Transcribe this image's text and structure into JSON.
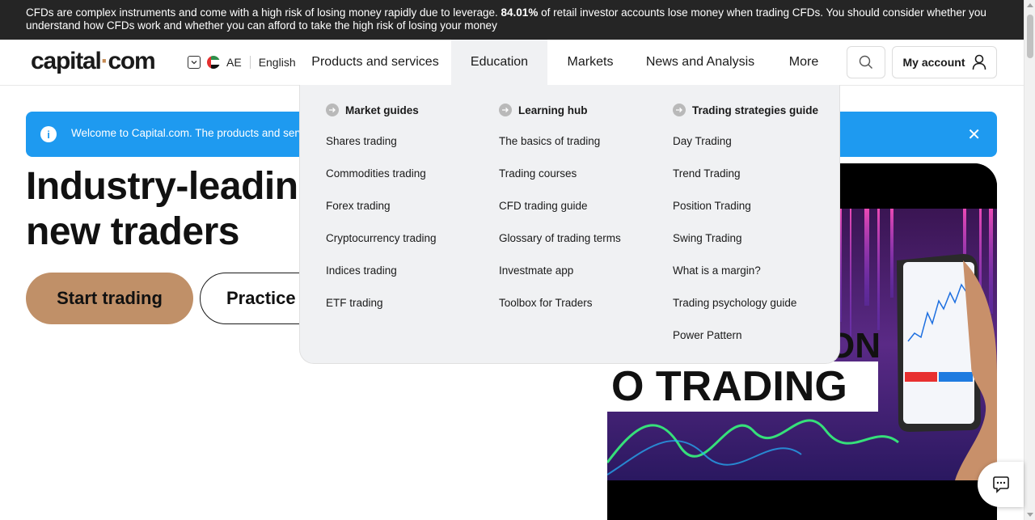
{
  "warning": {
    "text_before": "CFDs are complex instruments and come with a high risk of losing money rapidly due to leverage. ",
    "percent": "84.01%",
    "text_after": " of retail investor accounts lose money when trading CFDs. You should consider whether you understand how CFDs work and whether you can afford to take the high risk of losing your money"
  },
  "header": {
    "logo_left": "capital",
    "logo_dot": "·",
    "logo_right": "com",
    "region_code": "AE",
    "language": "English",
    "nav": [
      {
        "label": "Products and services"
      },
      {
        "label": "Education"
      },
      {
        "label": "Markets"
      },
      {
        "label": "News and Analysis"
      },
      {
        "label": "More"
      }
    ],
    "account_label": "My account"
  },
  "notice": {
    "text": "Welcome to Capital.com. The products and serv",
    "close": "✕"
  },
  "hero": {
    "title_line1": "Industry-leadin",
    "title_line2": "new traders",
    "start_label": "Start trading",
    "practice_label": "Practice"
  },
  "dropdown": {
    "columns": [
      {
        "title": "Market guides",
        "items": [
          "Shares trading",
          "Commodities trading",
          "Forex trading",
          "Cryptocurrency trading",
          "Indices trading",
          "ETF trading"
        ]
      },
      {
        "title": "Learning hub",
        "items": [
          "The basics of trading",
          "Trading courses",
          "CFD trading guide",
          "Glossary of trading terms",
          "Investmate app",
          "Toolbox for Traders"
        ]
      },
      {
        "title": "Trading strategies guide",
        "items": [
          "Day Trading",
          "Trend Trading",
          "Position Trading",
          "Swing Trading",
          "What is a margin?",
          "Trading psychology guide",
          "Power Pattern"
        ]
      }
    ]
  },
  "promo": {
    "text_fragment_1": "ON",
    "text_fragment_2": "O TRADING"
  },
  "colors": {
    "warning_bg": "#252525",
    "brand_dot": "#c58b54",
    "notice_bg": "#1e9af0",
    "start_btn_bg": "#c09068",
    "dropdown_bg": "#f0f1f3"
  }
}
